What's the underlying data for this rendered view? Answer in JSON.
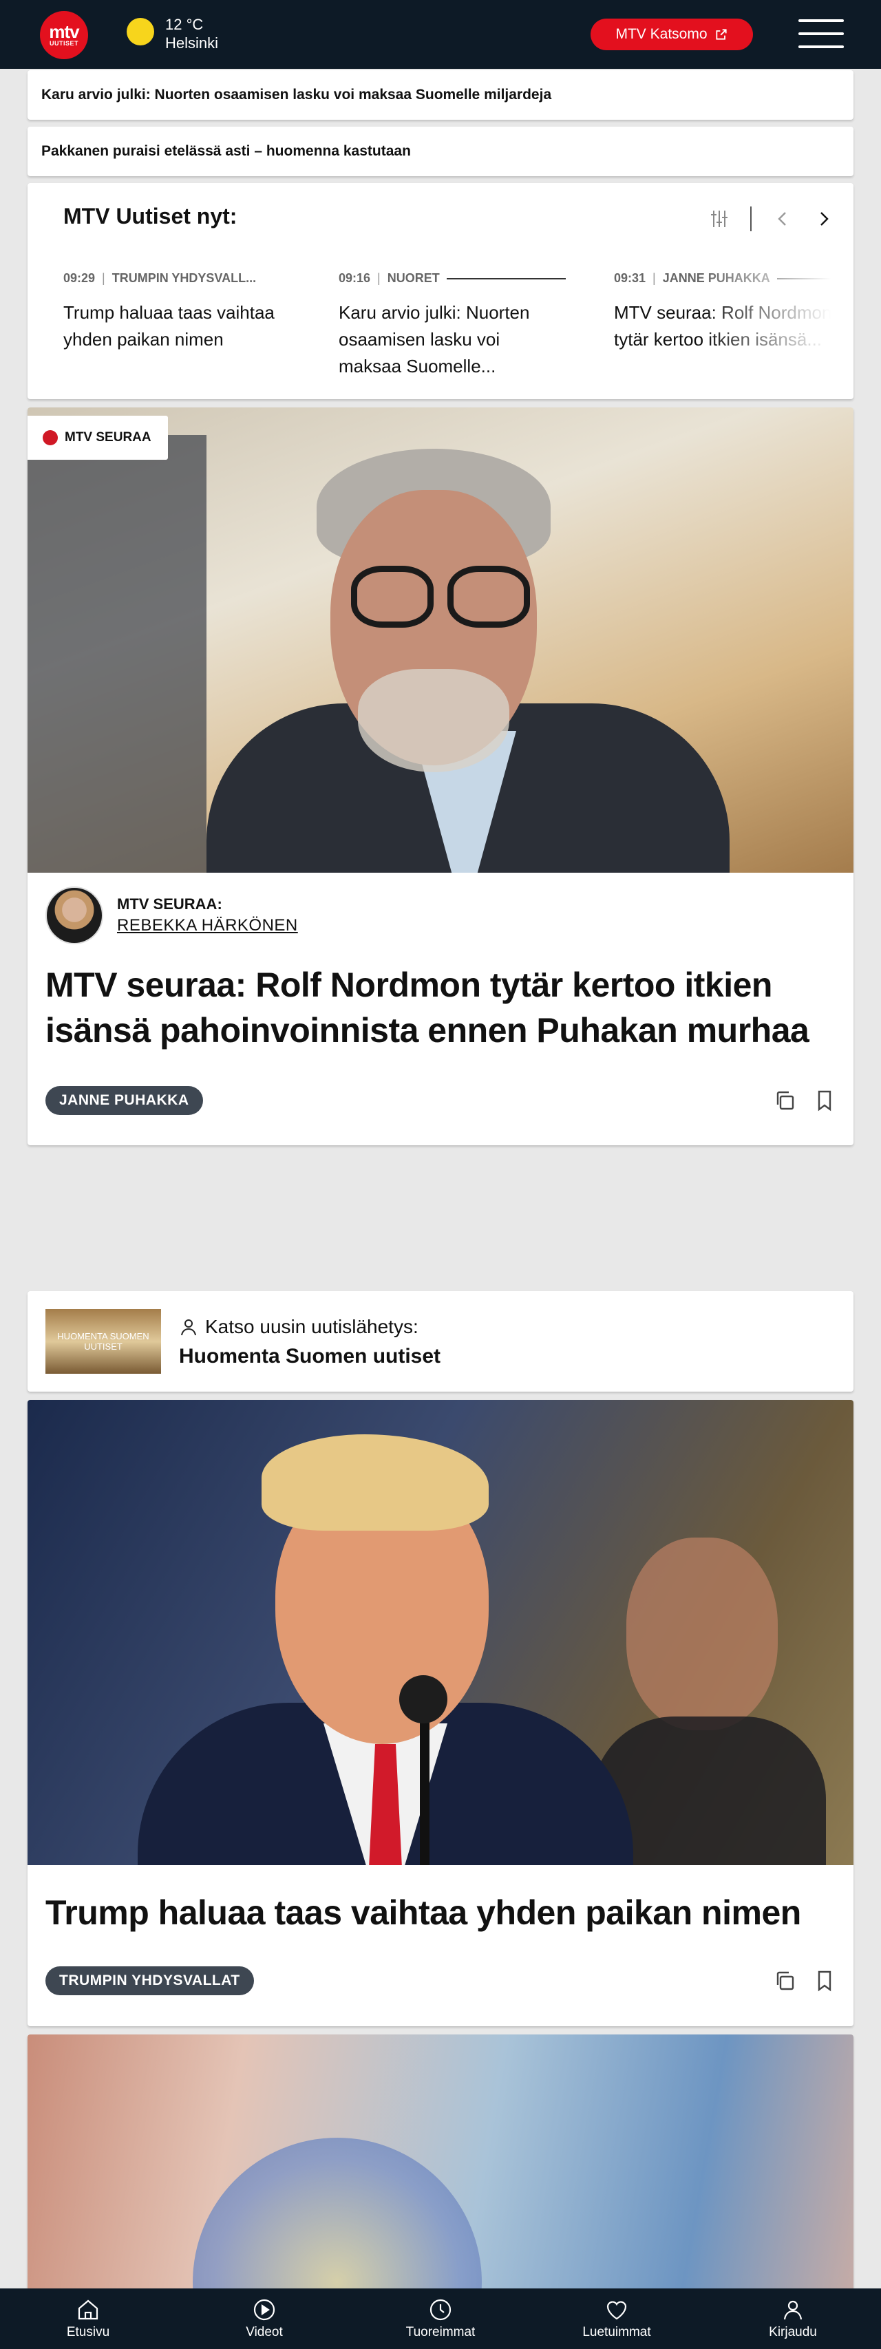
{
  "header": {
    "logo_top": "mtv",
    "logo_bottom": "UUTISET",
    "temperature": "12 °C",
    "city": "Helsinki",
    "katsomo_label": "MTV Katsomo",
    "icons": [
      "sun-icon",
      "external-link-icon",
      "hamburger-menu-icon"
    ]
  },
  "headlines": [
    "Karu arvio julki: Nuorten osaamisen lasku voi maksaa Suomelle miljardeja",
    "Pakkanen puraisi etelässä asti – huomenna kastutaan"
  ],
  "now": {
    "title": "MTV Uutiset nyt:",
    "items": [
      {
        "time": "09:29",
        "category": "TRUMPIN YHDYSVALL...",
        "text": "Trump haluaa taas vaihtaa yhden paikan nimen"
      },
      {
        "time": "09:16",
        "category": "NUORET",
        "text": "Karu arvio julki: Nuorten osaamisen lasku voi maksaa Suomelle..."
      },
      {
        "time": "09:31",
        "category": "JANNE PUHAKKA",
        "text": "MTV seuraa: Rolf Nordmon tytär kertoo itkien isänsä..."
      }
    ]
  },
  "article1": {
    "badge": "MTV SEURAA",
    "author_role": "MTV SEURAA:",
    "author_name": "REBEKKA HÄRKÖNEN",
    "title": "MTV seuraa: Rolf Nordmon tytär kertoo itkien isänsä pahoinvoinnista ennen Puhakan murhaa",
    "tag": "JANNE PUHAKKA"
  },
  "broadcast": {
    "thumb_text": "HUOMENTA SUOMEN UUTISET",
    "label": "Katso uusin uutislähetys:",
    "title": "Huomenta Suomen uutiset"
  },
  "article2": {
    "title": "Trump haluaa taas vaihtaa yhden paikan nimen",
    "tag": "TRUMPIN YHDYSVALLAT"
  },
  "bottom_nav": {
    "items": [
      {
        "label": "Etusivu",
        "icon": "home-icon"
      },
      {
        "label": "Videot",
        "icon": "play-icon"
      },
      {
        "label": "Tuoreimmat",
        "icon": "clock-icon"
      },
      {
        "label": "Luetuimmat",
        "icon": "heart-icon"
      },
      {
        "label": "Kirjaudu",
        "icon": "user-icon"
      }
    ]
  },
  "colors": {
    "header_bg": "#0d1a26",
    "brand_red": "#e3101e",
    "tag_bg": "#3e4752"
  }
}
